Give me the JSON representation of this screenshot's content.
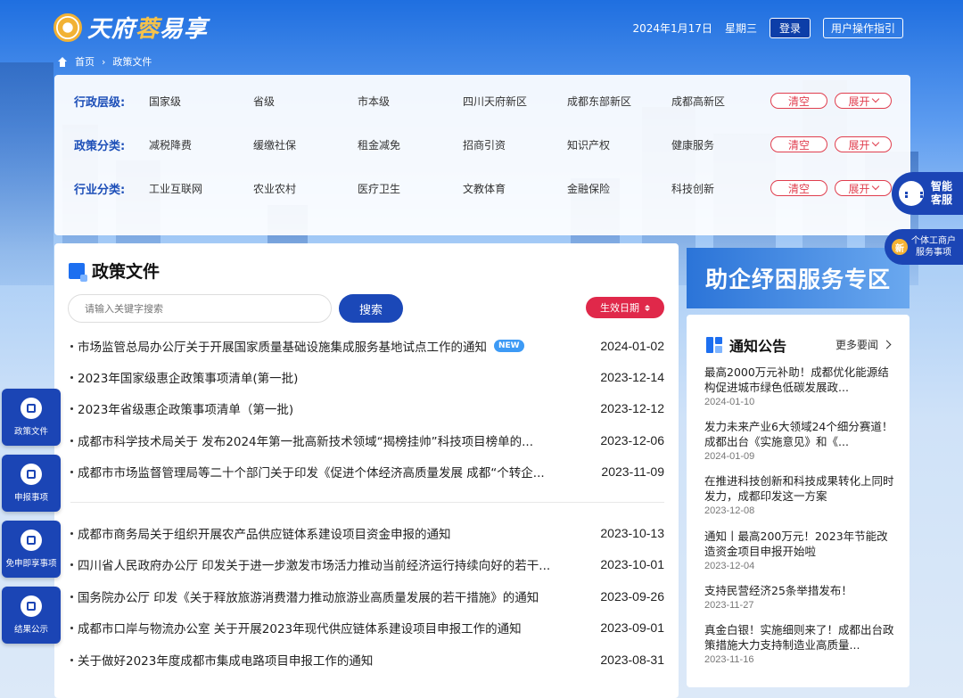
{
  "header": {
    "logo_parts": [
      "天府",
      "蓉",
      "易享"
    ],
    "date": "2024年1月17日",
    "weekday": "星期三",
    "login": "登录",
    "guide": "用户操作指引"
  },
  "breadcrumb": [
    "首页",
    "政策文件"
  ],
  "filters": [
    {
      "label": "行政层级:",
      "options": [
        "国家级",
        "省级",
        "市本级",
        "四川天府新区",
        "成都东部新区",
        "成都高新区"
      ]
    },
    {
      "label": "政策分类:",
      "options": [
        "减税降费",
        "缓缴社保",
        "租金减免",
        "招商引资",
        "知识产权",
        "健康服务"
      ]
    },
    {
      "label": "行业分类:",
      "options": [
        "工业互联网",
        "农业农村",
        "医疗卫生",
        "文教体育",
        "金融保险",
        "科技创新"
      ]
    }
  ],
  "filter_actions": {
    "clear": "清空",
    "expand": "展开"
  },
  "main": {
    "title": "政策文件",
    "search_placeholder": "请输入关键字搜索",
    "search_button": "搜索",
    "sort_button": "生效日期",
    "new_badge": "NEW",
    "policies": [
      {
        "title": "市场监管总局办公厅关于开展国家质量基础设施集成服务基地试点工作的通知",
        "date": "2024-01-02",
        "is_new": true
      },
      {
        "title": "2023年国家级惠企政策事项清单(第一批)",
        "date": "2023-12-14"
      },
      {
        "title": "2023年省级惠企政策事项清单（第一批)",
        "date": "2023-12-12"
      },
      {
        "title": "成都市科学技术局关于 发布2024年第一批高新技术领域“揭榜挂帅”科技项目榜单的...",
        "date": "2023-12-06"
      },
      {
        "title": "成都市市场监督管理局等二十个部门关于印发《促进个体经济高质量发展 成都“个转企...",
        "date": "2023-11-09"
      },
      {
        "title": "成都市商务局关于组织开展农产品供应链体系建设项目资金申报的通知",
        "date": "2023-10-13"
      },
      {
        "title": "四川省人民政府办公厅 印发关于进一步激发市场活力推动当前经济运行持续向好的若干...",
        "date": "2023-10-01"
      },
      {
        "title": "国务院办公厅 印发《关于释放旅游消费潜力推动旅游业高质量发展的若干措施》的通知",
        "date": "2023-09-26"
      },
      {
        "title": "成都市口岸与物流办公室 关于开展2023年现代供应链体系建设项目申报工作的通知",
        "date": "2023-09-01"
      },
      {
        "title": "关于做好2023年度成都市集成电路项目申报工作的通知",
        "date": "2023-08-31"
      }
    ]
  },
  "banner": "助企纾困服务专区",
  "notice": {
    "title": "通知公告",
    "more": "更多要闻",
    "items": [
      {
        "title": "最高2000万元补助！成都优化能源结构促进城市绿色低碳发展政...",
        "date": "2024-01-10"
      },
      {
        "title": "发力未来产业6大领域24个细分赛道！成都出台《实施意见》和《...",
        "date": "2024-01-09"
      },
      {
        "title": "在推进科技创新和科技成果转化上同时发力，成都印发这一方案",
        "date": "2023-12-08"
      },
      {
        "title": "通知丨最高200万元！2023年节能改造资金项目申报开始啦",
        "date": "2023-12-04"
      },
      {
        "title": "支持民营经济25条举措发布！",
        "date": "2023-11-27"
      },
      {
        "title": "真金白银！实施细则来了！成都出台政策措施大力支持制造业高质量...",
        "date": "2023-11-16"
      }
    ]
  },
  "left_nav": [
    "政策文件",
    "申报事项",
    "免申即享事项",
    "结果公示"
  ],
  "float_right": {
    "service_lines": [
      "智能",
      "客服"
    ],
    "new_dot": "新",
    "individual_lines": [
      "个体工商户",
      "服务事项"
    ]
  },
  "colors": {
    "primary": "#1b45b5",
    "accent_red": "#e0284a",
    "label_blue": "#1d4fb8"
  }
}
